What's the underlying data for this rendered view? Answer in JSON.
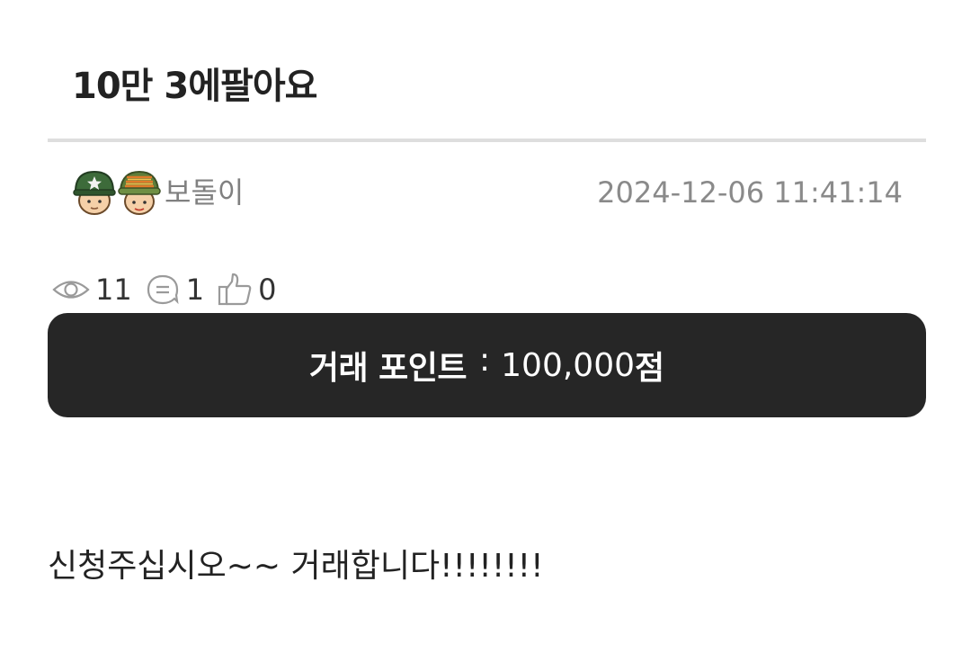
{
  "post": {
    "title": "10만 3에팔아요",
    "author": "보돌이",
    "date": "2024-12-06 11:41:14",
    "body": "신청주십시오~~ 거래합니다!!!!!!!!"
  },
  "stats": {
    "views": "11",
    "comments": "1",
    "likes": "0"
  },
  "trade": {
    "label": "거래 포인트",
    "separator": ":",
    "amount": "100,000",
    "unit": "점"
  },
  "icons": {
    "avatar_1": "army-helmet-avatar-icon",
    "avatar_2": "rank-badge-avatar-icon",
    "views": "eye-icon",
    "comments": "comment-bubble-icon",
    "likes": "thumbs-up-icon"
  },
  "colors": {
    "trade_box_background": "#262626",
    "divider": "#dedede",
    "meta_text": "#8a8a8a"
  }
}
